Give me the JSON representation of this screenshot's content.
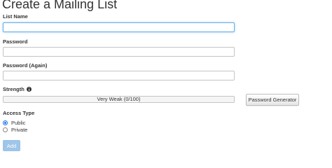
{
  "page": {
    "title": "Create a Mailing List"
  },
  "form": {
    "list_name": {
      "label": "List Name",
      "value": ""
    },
    "password": {
      "label": "Password",
      "value": ""
    },
    "password_again": {
      "label": "Password (Again)",
      "value": ""
    },
    "strength": {
      "label": "Strength",
      "icon": "info-icon",
      "text": "Very Weak (0/100)",
      "score": 0
    },
    "generator_button": "Password Generator",
    "access_type": {
      "label": "Access Type",
      "options": [
        "Public",
        "Private"
      ],
      "selected": "Public"
    },
    "add_button": "Add"
  },
  "colors": {
    "focus": "#66afe9",
    "accent": "#1a73e8",
    "add_button": "#9ec5ea"
  }
}
